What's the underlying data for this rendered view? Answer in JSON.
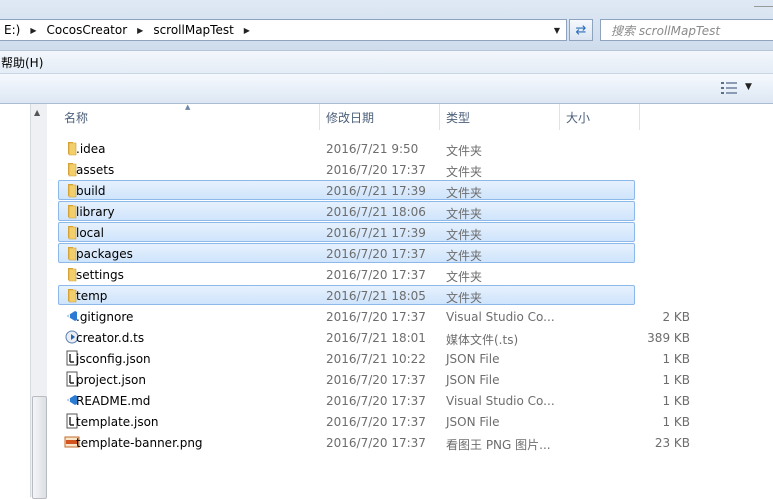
{
  "address": {
    "crumbs": [
      "E:)",
      "CocosCreator",
      "scrollMapTest"
    ]
  },
  "search": {
    "placeholder": "搜索 scrollMapTest"
  },
  "menu": {
    "help_label": "帮助(H)"
  },
  "columns": {
    "name": "名称",
    "date": "修改日期",
    "type": "类型",
    "size": "大小"
  },
  "files": [
    {
      "name": ".idea",
      "date": "2016/7/21 9:50",
      "type": "文件夹",
      "size": "",
      "icon": "folder-icon",
      "selected": false
    },
    {
      "name": "assets",
      "date": "2016/7/20 17:37",
      "type": "文件夹",
      "size": "",
      "icon": "folder-icon",
      "selected": false
    },
    {
      "name": "build",
      "date": "2016/7/21 17:39",
      "type": "文件夹",
      "size": "",
      "icon": "folder-icon",
      "selected": true
    },
    {
      "name": "library",
      "date": "2016/7/21 18:06",
      "type": "文件夹",
      "size": "",
      "icon": "folder-icon",
      "selected": true
    },
    {
      "name": "local",
      "date": "2016/7/21 17:39",
      "type": "文件夹",
      "size": "",
      "icon": "folder-icon",
      "selected": true
    },
    {
      "name": "packages",
      "date": "2016/7/20 17:37",
      "type": "文件夹",
      "size": "",
      "icon": "folder-icon",
      "selected": true
    },
    {
      "name": "settings",
      "date": "2016/7/20 17:37",
      "type": "文件夹",
      "size": "",
      "icon": "folder-icon",
      "selected": false
    },
    {
      "name": "temp",
      "date": "2016/7/21 18:05",
      "type": "文件夹",
      "size": "",
      "icon": "folder-icon",
      "selected": true
    },
    {
      "name": ".gitignore",
      "date": "2016/7/20 17:37",
      "type": "Visual Studio Co...",
      "size": "2 KB",
      "icon": "vscode-file-icon",
      "selected": false
    },
    {
      "name": "creator.d.ts",
      "date": "2016/7/21 18:01",
      "type": "媒体文件(.ts)",
      "size": "389 KB",
      "icon": "media-file-icon",
      "selected": false
    },
    {
      "name": "jsconfig.json",
      "date": "2016/7/21 10:22",
      "type": "JSON File",
      "size": "1 KB",
      "icon": "json-file-icon",
      "selected": false
    },
    {
      "name": "project.json",
      "date": "2016/7/20 17:37",
      "type": "JSON File",
      "size": "1 KB",
      "icon": "json-file-icon",
      "selected": false
    },
    {
      "name": "README.md",
      "date": "2016/7/20 17:37",
      "type": "Visual Studio Co...",
      "size": "1 KB",
      "icon": "vscode-file-icon",
      "selected": false
    },
    {
      "name": "template.json",
      "date": "2016/7/20 17:37",
      "type": "JSON File",
      "size": "1 KB",
      "icon": "json-file-icon",
      "selected": false
    },
    {
      "name": "template-banner.png",
      "date": "2016/7/20 17:37",
      "type": "看图王 PNG 图片...",
      "size": "23 KB",
      "icon": "png-file-icon",
      "selected": false
    }
  ],
  "colors": {
    "selection_bg": "#cfe4fc",
    "selection_border": "#8db8ea",
    "header_text": "#4c607a",
    "folder": "#e8bf52"
  }
}
